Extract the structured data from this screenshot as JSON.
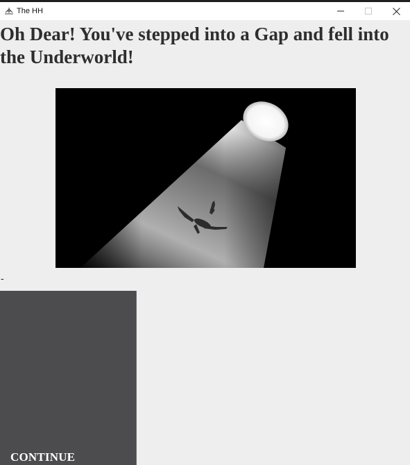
{
  "window": {
    "title": "The HH",
    "icon": "app-logo-icon",
    "controls": [
      "minimize-icon",
      "maximize-icon",
      "close-icon"
    ]
  },
  "main": {
    "headline": "Oh Dear! You've stepped into a Gap and fell into the Underworld!",
    "image": "falling-figure-spotlight-image",
    "separator": "-",
    "continue_label": "CONTINUE"
  },
  "colors": {
    "background": "#eeeeee",
    "panel": "#4c4c4e",
    "heading": "#2e2e2e",
    "button_text": "#ffffff"
  }
}
